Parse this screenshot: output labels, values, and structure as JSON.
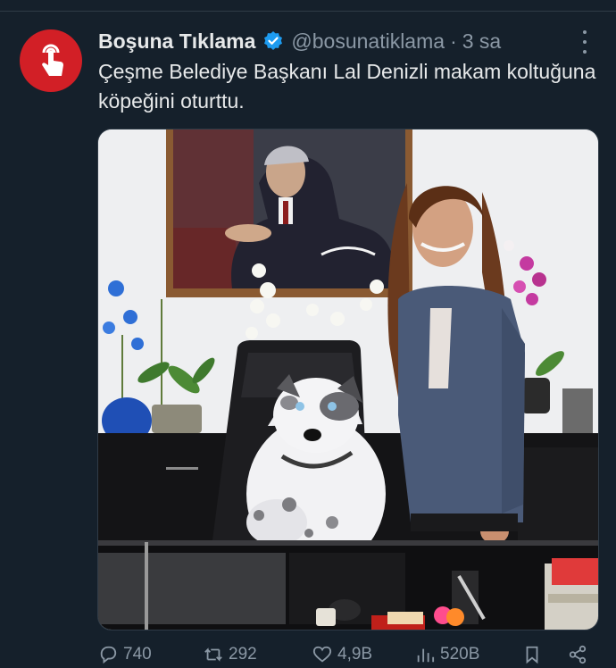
{
  "tweet": {
    "author_name": "Boşuna Tıklama",
    "handle": "@bosunatiklama",
    "separator": "·",
    "time": "3 sa",
    "text": "Çeşme Belediye Başkanı Lal Denizli makam koltuğuna köpeğini oturttu."
  },
  "stats": {
    "replies": "740",
    "retweets": "292",
    "likes": "4,9B",
    "views": "520B"
  },
  "icons": {
    "avatar": "tap-finger-icon",
    "verified": "verified-badge-icon",
    "more": "more-icon",
    "reply": "reply-icon",
    "retweet": "retweet-icon",
    "like": "heart-icon",
    "views": "views-icon",
    "bookmark": "bookmark-icon",
    "share": "share-icon"
  },
  "colors": {
    "background": "#15202b",
    "text": "#e7e9ea",
    "secondary": "#8b98a5",
    "verified": "#1d9bf0",
    "avatar": "#d21f26"
  }
}
